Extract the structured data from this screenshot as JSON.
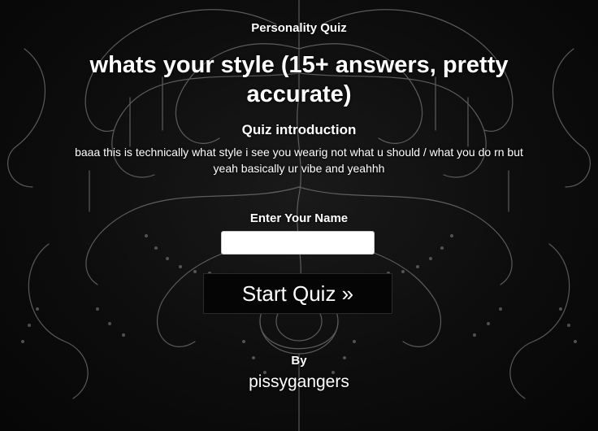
{
  "header": {
    "quiz_type": "Personality Quiz",
    "title": "whats your style (15+ answers, pretty accurate)"
  },
  "intro": {
    "heading": "Quiz introduction",
    "text": "baaa this is technically what style i see you wearig not what u should / what you do rn but yeah basically ur vibe and yeahhh"
  },
  "form": {
    "name_label": "Enter Your Name",
    "name_value": "",
    "start_label": "Start Quiz »"
  },
  "author": {
    "by_label": "By",
    "name": "pissygangers"
  },
  "background": {
    "description_icon": "ornate-chandelier-artwork",
    "base_color": "#0b0b0b",
    "line_color": "#9a9a9a"
  }
}
